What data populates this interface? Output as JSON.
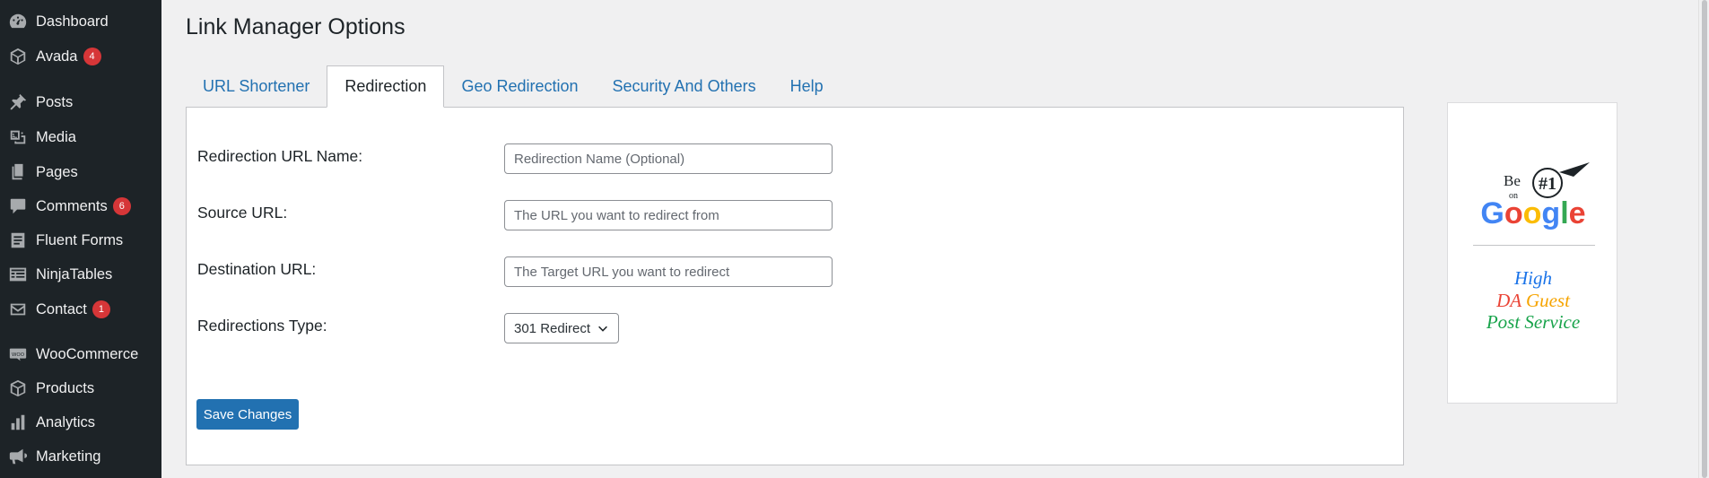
{
  "sidebar": {
    "items": [
      {
        "label": "Dashboard",
        "icon": "dashboard-icon"
      },
      {
        "label": "Avada",
        "icon": "avada-icon",
        "badge": "4"
      },
      {
        "label": "Posts",
        "icon": "pin-icon"
      },
      {
        "label": "Media",
        "icon": "media-icon"
      },
      {
        "label": "Pages",
        "icon": "pages-icon"
      },
      {
        "label": "Comments",
        "icon": "comment-icon",
        "badge": "6"
      },
      {
        "label": "Fluent Forms",
        "icon": "forms-icon"
      },
      {
        "label": "NinjaTables",
        "icon": "table-icon"
      },
      {
        "label": "Contact",
        "icon": "mail-icon",
        "badge": "1"
      },
      {
        "label": "WooCommerce",
        "icon": "woo-icon"
      },
      {
        "label": "Products",
        "icon": "box-icon"
      },
      {
        "label": "Analytics",
        "icon": "bar-chart-icon"
      },
      {
        "label": "Marketing",
        "icon": "megaphone-icon"
      }
    ]
  },
  "page": {
    "title": "Link Manager Options"
  },
  "tabs": [
    {
      "label": "URL Shortener",
      "active": false
    },
    {
      "label": "Redirection",
      "active": true
    },
    {
      "label": "Geo Redirection",
      "active": false
    },
    {
      "label": "Security And Others",
      "active": false
    },
    {
      "label": "Help",
      "active": false
    }
  ],
  "form": {
    "name_label": "Redirection URL Name:",
    "name_placeholder": "Redirection Name (Optional)",
    "name_value": "",
    "source_label": "Source URL:",
    "source_placeholder": "The URL you want to redirect from",
    "source_value": "",
    "dest_label": "Destination URL:",
    "dest_placeholder": "The Target URL you want to redirect",
    "dest_value": "",
    "type_label": "Redirections Type:",
    "type_value": "301 Redirect",
    "save_label": "Save Changes"
  },
  "ad": {
    "line1": "High",
    "line2": "DA Guest",
    "line3": "Post Service",
    "logo_text": {
      "be": "Be",
      "on": "on",
      "number": "#1",
      "google": "Google"
    },
    "colors": {
      "blue": "#1a73e8",
      "red": "#ea4335",
      "orange": "#f6a400",
      "green": "#17a34a"
    }
  },
  "colors": {
    "sidebar_bg": "#1d2327",
    "accent": "#2271b1",
    "badge": "#d63638",
    "page_bg": "#f0f0f1"
  }
}
